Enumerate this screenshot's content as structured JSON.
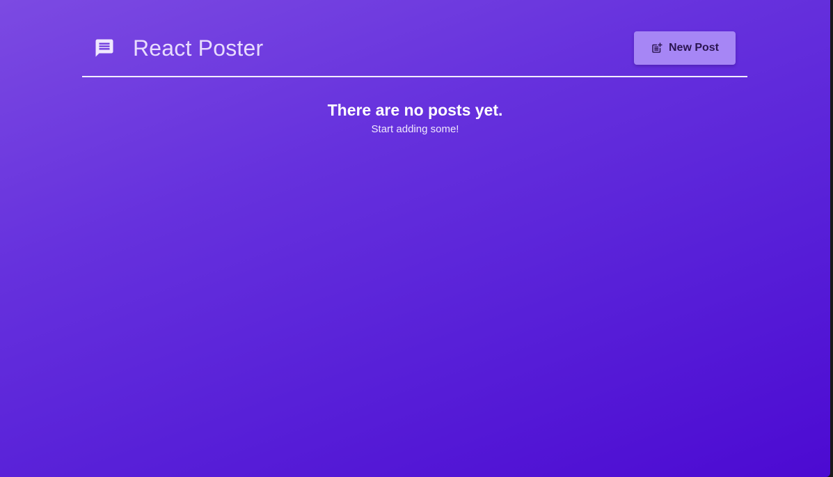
{
  "header": {
    "logo_icon": "message-icon",
    "title": "React Poster",
    "new_post_button": {
      "icon": "post-add-icon",
      "label": "New Post"
    }
  },
  "empty_state": {
    "title": "There are no posts yet.",
    "subtitle": "Start adding some!"
  },
  "colors": {
    "gradient_start": "#7c4ae2",
    "gradient_end": "#4c0ad2",
    "button_bg": "#a686f5",
    "button_text": "#2b1550",
    "title_text": "#e8dcfd"
  }
}
